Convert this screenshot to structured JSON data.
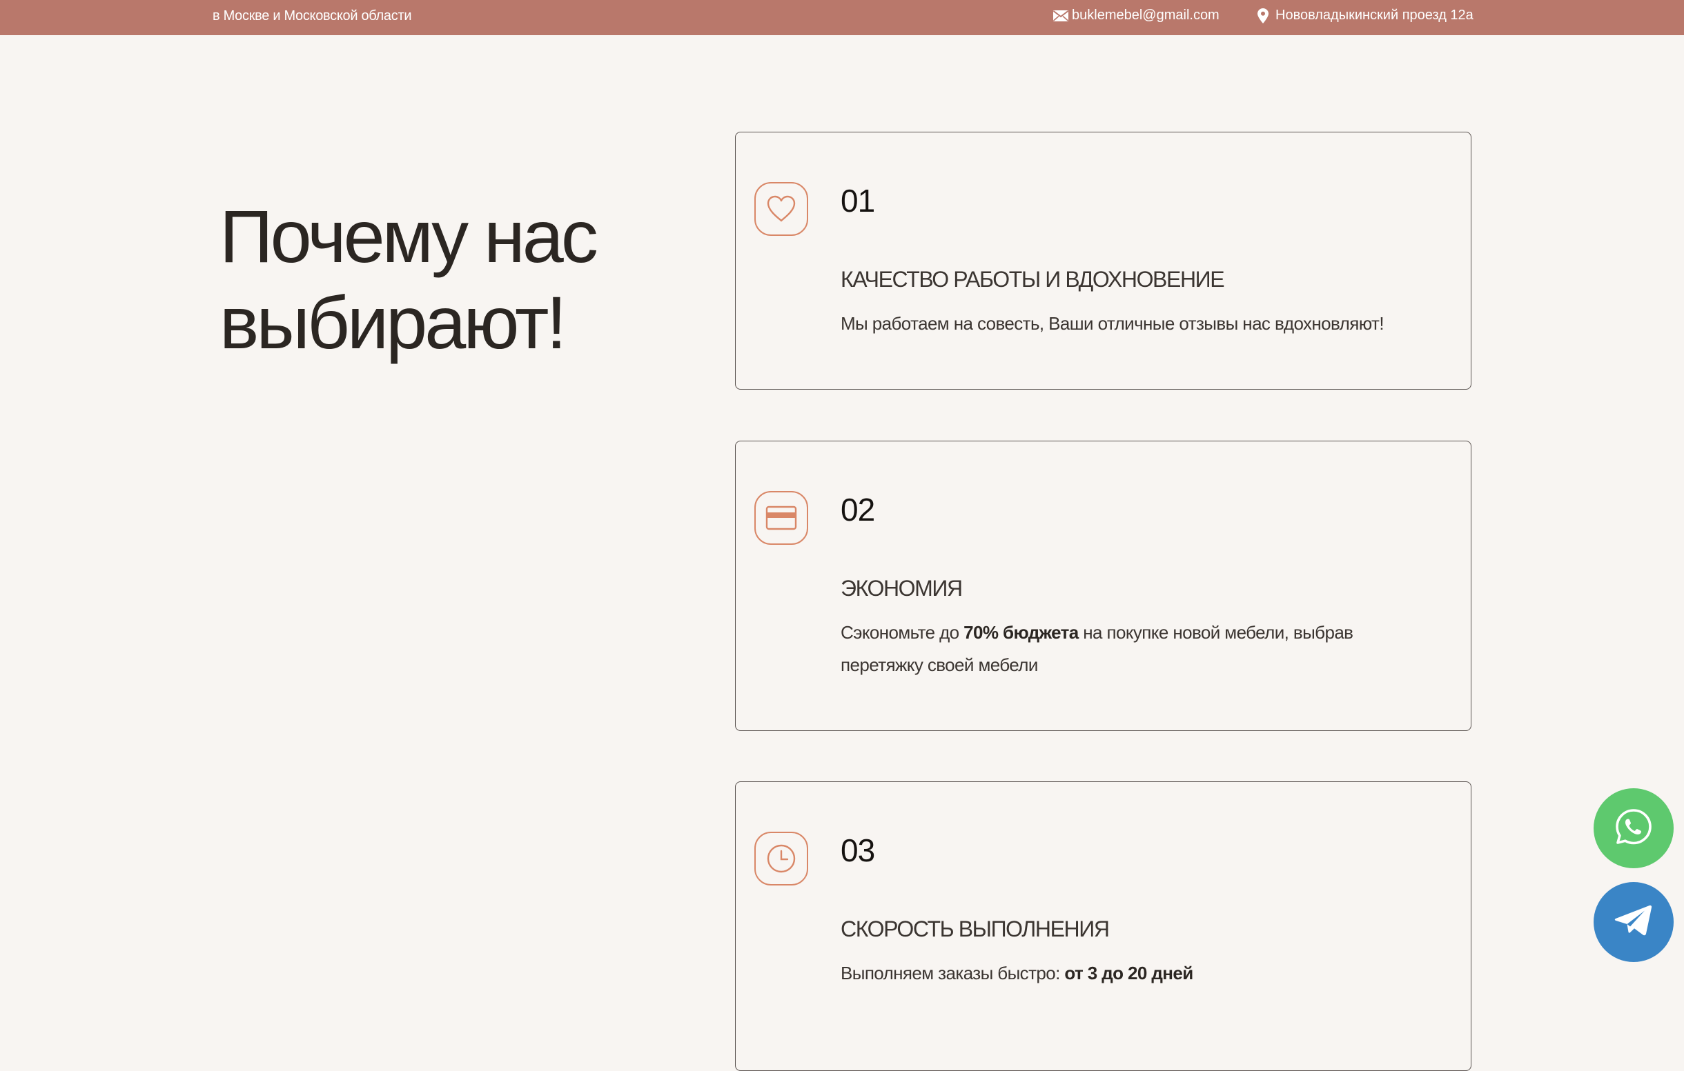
{
  "topbar": {
    "region": "в Москве и Московской области",
    "email": "buklemebel@gmail.com",
    "address": "Нововладыкинский проезд 12а",
    "icons": {
      "email": "envelope-icon",
      "address": "map-pin-icon"
    }
  },
  "heading": {
    "line1": "Почему нас",
    "line2": "выбирают!"
  },
  "cards": [
    {
      "icon": "heart-icon",
      "number": "01",
      "title": "КАЧЕСТВО РАБОТЫ И ВДОХНОВЕНИЕ",
      "text": "Мы работаем на совесть, Ваши отличные отзывы нас вдохновляют!"
    },
    {
      "icon": "credit-card-icon",
      "number": "02",
      "title": "ЭКОНОМИЯ",
      "text_before": "Сэкономьте до ",
      "text_bold": "70% бюджета",
      "text_after": " на покупке новой мебели, выбрав перетяжку своей мебели"
    },
    {
      "icon": "clock-icon",
      "number": "03",
      "title": "СКОРОСТЬ ВЫПОЛНЕНИЯ",
      "text_before": "Выполняем заказы быстро: ",
      "text_bold": "от 3 до 20 дней"
    }
  ],
  "floating": {
    "whatsapp_icon": "whatsapp-icon",
    "telegram_icon": "telegram-icon"
  },
  "colors": {
    "topbar": "#b9786b",
    "background": "#f8f5f2",
    "accent": "#d98767",
    "whatsapp": "#5ec96e",
    "telegram": "#3a85c6"
  }
}
